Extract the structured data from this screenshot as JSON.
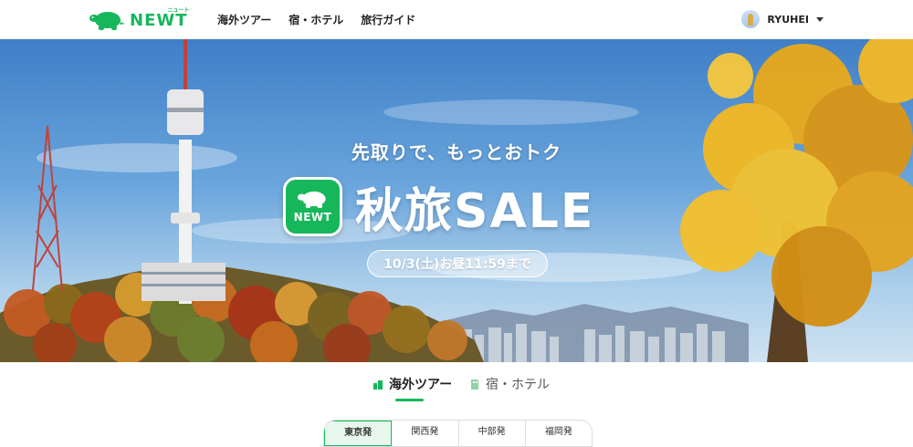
{
  "brand": {
    "name": "NEWT",
    "kana": "ニュート",
    "accent": "#16b75a"
  },
  "nav": [
    {
      "label": "海外ツアー"
    },
    {
      "label": "宿・ホテル"
    },
    {
      "label": "旅行ガイド"
    }
  ],
  "user": {
    "name": "RYUHEI"
  },
  "hero": {
    "subtitle": "先取りで、もっとおトク",
    "icon_word": "NEWT",
    "title": "秋旅SALE",
    "deadline": "10/3(土)お昼11:59まで"
  },
  "tabs": [
    {
      "label": "海外ツアー",
      "icon": "tour-icon",
      "active": true
    },
    {
      "label": "宿・ホテル",
      "icon": "hotel-icon",
      "active": false
    }
  ],
  "departures": [
    {
      "label": "東京発",
      "active": true
    },
    {
      "label": "関西発",
      "active": false
    },
    {
      "label": "中部発",
      "active": false
    },
    {
      "label": "福岡発",
      "active": false
    }
  ]
}
